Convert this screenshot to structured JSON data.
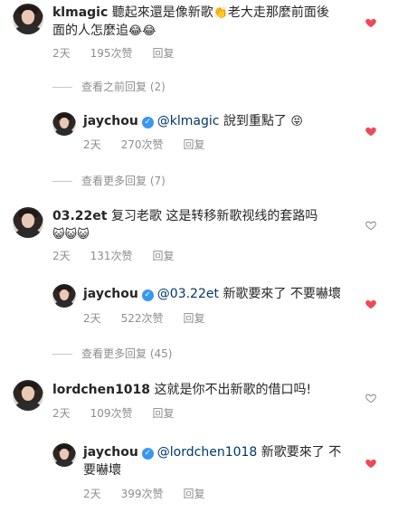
{
  "comments": [
    {
      "username": "klmagic",
      "line1": "聽起來還是像新歌",
      "clap": "👏",
      "line1b": "老大走那麼前面後",
      "line2": "面的人怎麼追",
      "emoji2": "😂😂",
      "time": "2天",
      "likes": "195次赞",
      "reply_label": "回复",
      "liked": true,
      "more": "查看之前回复 (2)",
      "reply": {
        "username": "jaychou",
        "mention": "@klmagic",
        "text": "說到重點了",
        "emoji": "😝",
        "time": "2天",
        "likes": "270次赞",
        "reply_label": "回复",
        "liked": true
      },
      "more_after": "查看更多回复 (7)"
    },
    {
      "username": "03.22et",
      "line1": "复习老歌 这是转移新歌视线的套路吗",
      "line2": "😺😺😺",
      "time": "2天",
      "likes": "131次赞",
      "reply_label": "回复",
      "liked": false,
      "reply": {
        "username": "jaychou",
        "mention": "@03.22et",
        "text": "新歌要來了 不要嚇壞",
        "time": "2天",
        "likes": "522次赞",
        "reply_label": "回复",
        "liked": true
      },
      "more_after": "查看更多回复 (45)"
    },
    {
      "username": "lordchen1018",
      "line1": "这就是你不出新歌的借口吗!",
      "time": "2天",
      "likes": "109次赞",
      "reply_label": "回复",
      "liked": false,
      "reply": {
        "username": "jaychou",
        "mention": "@lordchen1018",
        "text": "新歌要來了 不",
        "text2": "要嚇壞",
        "time": "2天",
        "likes": "399次赞",
        "reply_label": "回复",
        "liked": true
      }
    }
  ],
  "verified_mark": "✓",
  "colors": {
    "heart_liked": "#ed4956",
    "heart_empty": "#8e8e8e",
    "mention": "#00376b",
    "meta": "#8e8e8e"
  }
}
